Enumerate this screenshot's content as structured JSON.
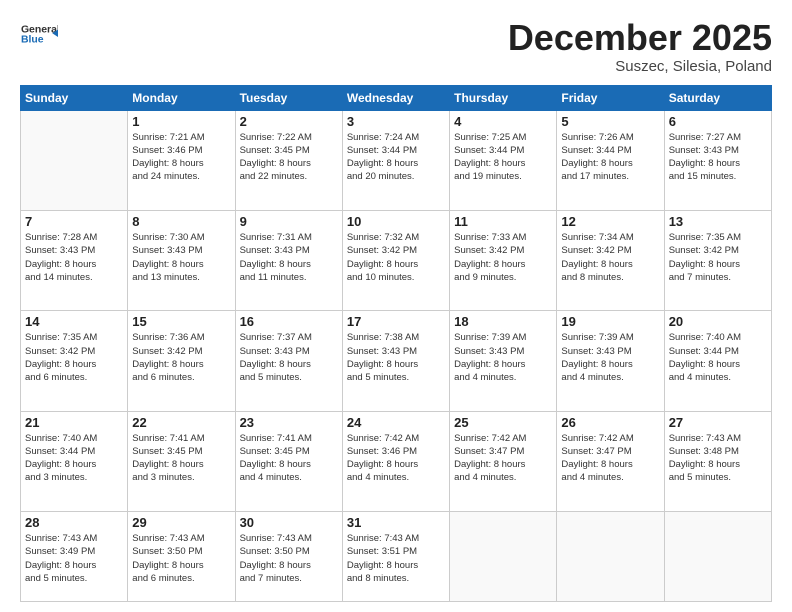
{
  "header": {
    "logo_line1": "General",
    "logo_line2": "Blue",
    "month": "December 2025",
    "location": "Suszec, Silesia, Poland"
  },
  "weekdays": [
    "Sunday",
    "Monday",
    "Tuesday",
    "Wednesday",
    "Thursday",
    "Friday",
    "Saturday"
  ],
  "weeks": [
    [
      {
        "day": "",
        "info": ""
      },
      {
        "day": "1",
        "info": "Sunrise: 7:21 AM\nSunset: 3:46 PM\nDaylight: 8 hours\nand 24 minutes."
      },
      {
        "day": "2",
        "info": "Sunrise: 7:22 AM\nSunset: 3:45 PM\nDaylight: 8 hours\nand 22 minutes."
      },
      {
        "day": "3",
        "info": "Sunrise: 7:24 AM\nSunset: 3:44 PM\nDaylight: 8 hours\nand 20 minutes."
      },
      {
        "day": "4",
        "info": "Sunrise: 7:25 AM\nSunset: 3:44 PM\nDaylight: 8 hours\nand 19 minutes."
      },
      {
        "day": "5",
        "info": "Sunrise: 7:26 AM\nSunset: 3:44 PM\nDaylight: 8 hours\nand 17 minutes."
      },
      {
        "day": "6",
        "info": "Sunrise: 7:27 AM\nSunset: 3:43 PM\nDaylight: 8 hours\nand 15 minutes."
      }
    ],
    [
      {
        "day": "7",
        "info": "Sunrise: 7:28 AM\nSunset: 3:43 PM\nDaylight: 8 hours\nand 14 minutes."
      },
      {
        "day": "8",
        "info": "Sunrise: 7:30 AM\nSunset: 3:43 PM\nDaylight: 8 hours\nand 13 minutes."
      },
      {
        "day": "9",
        "info": "Sunrise: 7:31 AM\nSunset: 3:43 PM\nDaylight: 8 hours\nand 11 minutes."
      },
      {
        "day": "10",
        "info": "Sunrise: 7:32 AM\nSunset: 3:42 PM\nDaylight: 8 hours\nand 10 minutes."
      },
      {
        "day": "11",
        "info": "Sunrise: 7:33 AM\nSunset: 3:42 PM\nDaylight: 8 hours\nand 9 minutes."
      },
      {
        "day": "12",
        "info": "Sunrise: 7:34 AM\nSunset: 3:42 PM\nDaylight: 8 hours\nand 8 minutes."
      },
      {
        "day": "13",
        "info": "Sunrise: 7:35 AM\nSunset: 3:42 PM\nDaylight: 8 hours\nand 7 minutes."
      }
    ],
    [
      {
        "day": "14",
        "info": "Sunrise: 7:35 AM\nSunset: 3:42 PM\nDaylight: 8 hours\nand 6 minutes."
      },
      {
        "day": "15",
        "info": "Sunrise: 7:36 AM\nSunset: 3:42 PM\nDaylight: 8 hours\nand 6 minutes."
      },
      {
        "day": "16",
        "info": "Sunrise: 7:37 AM\nSunset: 3:43 PM\nDaylight: 8 hours\nand 5 minutes."
      },
      {
        "day": "17",
        "info": "Sunrise: 7:38 AM\nSunset: 3:43 PM\nDaylight: 8 hours\nand 5 minutes."
      },
      {
        "day": "18",
        "info": "Sunrise: 7:39 AM\nSunset: 3:43 PM\nDaylight: 8 hours\nand 4 minutes."
      },
      {
        "day": "19",
        "info": "Sunrise: 7:39 AM\nSunset: 3:43 PM\nDaylight: 8 hours\nand 4 minutes."
      },
      {
        "day": "20",
        "info": "Sunrise: 7:40 AM\nSunset: 3:44 PM\nDaylight: 8 hours\nand 4 minutes."
      }
    ],
    [
      {
        "day": "21",
        "info": "Sunrise: 7:40 AM\nSunset: 3:44 PM\nDaylight: 8 hours\nand 3 minutes."
      },
      {
        "day": "22",
        "info": "Sunrise: 7:41 AM\nSunset: 3:45 PM\nDaylight: 8 hours\nand 3 minutes."
      },
      {
        "day": "23",
        "info": "Sunrise: 7:41 AM\nSunset: 3:45 PM\nDaylight: 8 hours\nand 4 minutes."
      },
      {
        "day": "24",
        "info": "Sunrise: 7:42 AM\nSunset: 3:46 PM\nDaylight: 8 hours\nand 4 minutes."
      },
      {
        "day": "25",
        "info": "Sunrise: 7:42 AM\nSunset: 3:47 PM\nDaylight: 8 hours\nand 4 minutes."
      },
      {
        "day": "26",
        "info": "Sunrise: 7:42 AM\nSunset: 3:47 PM\nDaylight: 8 hours\nand 4 minutes."
      },
      {
        "day": "27",
        "info": "Sunrise: 7:43 AM\nSunset: 3:48 PM\nDaylight: 8 hours\nand 5 minutes."
      }
    ],
    [
      {
        "day": "28",
        "info": "Sunrise: 7:43 AM\nSunset: 3:49 PM\nDaylight: 8 hours\nand 5 minutes."
      },
      {
        "day": "29",
        "info": "Sunrise: 7:43 AM\nSunset: 3:50 PM\nDaylight: 8 hours\nand 6 minutes."
      },
      {
        "day": "30",
        "info": "Sunrise: 7:43 AM\nSunset: 3:50 PM\nDaylight: 8 hours\nand 7 minutes."
      },
      {
        "day": "31",
        "info": "Sunrise: 7:43 AM\nSunset: 3:51 PM\nDaylight: 8 hours\nand 8 minutes."
      },
      {
        "day": "",
        "info": ""
      },
      {
        "day": "",
        "info": ""
      },
      {
        "day": "",
        "info": ""
      }
    ]
  ]
}
